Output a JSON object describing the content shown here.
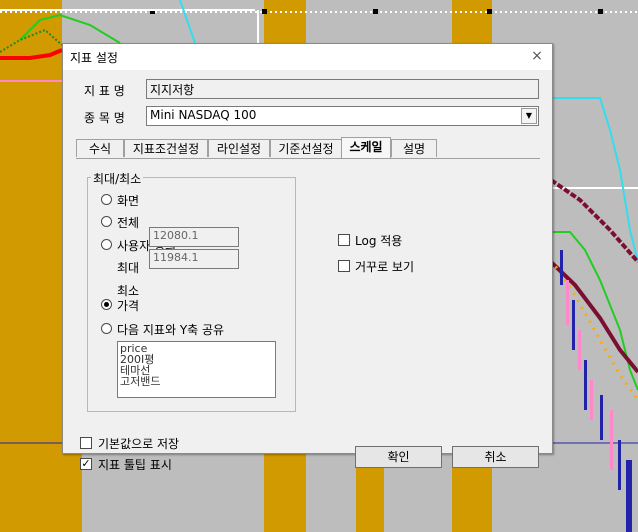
{
  "dialog": {
    "title": "지표 설정",
    "close_symbol": "×",
    "indicator_name_label": "지 표 명",
    "indicator_name_value": "지지저항",
    "symbol_label": "종 목 명",
    "symbol_value": "Mini NASDAQ 100",
    "tabs": [
      {
        "label": "수식"
      },
      {
        "label": "지표조건설정"
      },
      {
        "label": "라인설정"
      },
      {
        "label": "기준선설정"
      },
      {
        "label": "스케일"
      },
      {
        "label": "설명"
      }
    ],
    "active_tab": "스케일",
    "group_title": "최대/최소",
    "radios": {
      "screen": "화면",
      "all": "전체",
      "user": "사용자 정의",
      "price": "가격",
      "share": "다음 지표와 Y축 공유"
    },
    "selected_radio": "가격",
    "max_label": "최대",
    "max_value": "12080.1",
    "min_label": "최소",
    "min_value": "11984.1",
    "share_list": [
      "price",
      "200I평",
      "테마선",
      "고저밴드"
    ],
    "log_label": "Log 적용",
    "log_checked": false,
    "invert_label": "거꾸로 보기",
    "invert_checked": false,
    "default_save_label": "기본값으로 저장",
    "default_save_checked": false,
    "tooltip_label": "지표 툴팁 표시",
    "tooltip_checked": true,
    "ok_label": "확인",
    "cancel_label": "취소"
  },
  "colors": {
    "background": "#bdbdbd",
    "gold_band": "#d19a00",
    "blue_line": "#2222aa",
    "cyan_line": "#33ddee",
    "green_line": "#22cc22",
    "maroon_line": "#7a1030",
    "red_line": "#ff0000"
  }
}
